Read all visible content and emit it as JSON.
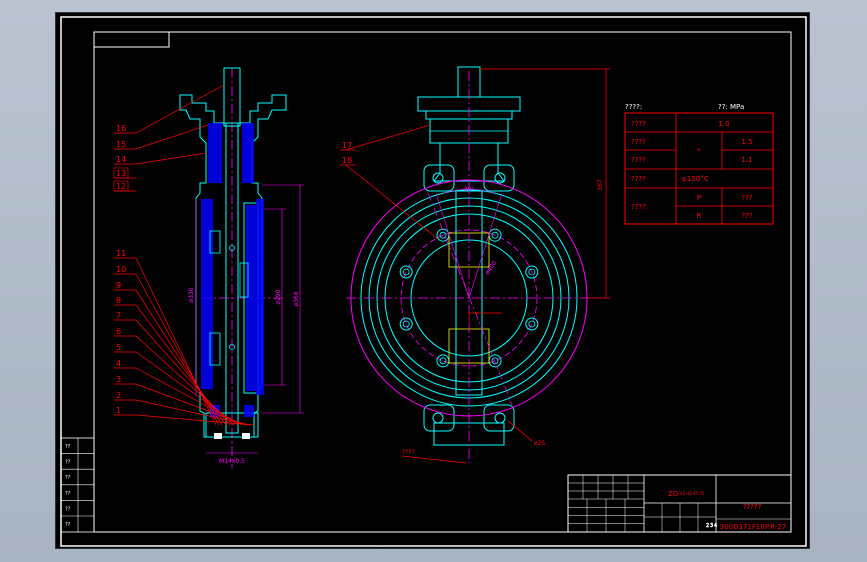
{
  "colors": {
    "background": "#000000",
    "frame": "#ffffff",
    "outline": "#00ffff",
    "leader": "#ff0000",
    "hatch": "#0000ff",
    "dimension": "#ff00ff",
    "centerline": "#ffff00",
    "text_white": "#ffffff"
  },
  "part_numbers_left": [
    "16",
    "15",
    "14",
    "13",
    "12",
    "11",
    "10",
    "9",
    "8",
    "7",
    "6",
    "5",
    "4",
    "3",
    "2",
    "1"
  ],
  "part_numbers_right": [
    "17",
    "18"
  ],
  "dimensions": {
    "flange_dia": "ø330",
    "seat_dia": "ø290",
    "outer_dia": "ø368",
    "height": "367",
    "bolt_circle": "ø25",
    "angle": "30°",
    "pcd": "ø400",
    "bottom_thread": "M14x0.5",
    "bottom_note": "????"
  },
  "spec_table": {
    "header_left": "????:",
    "header_right": "??: MPa",
    "rows": [
      {
        "label": "????",
        "mid": "",
        "value": "1.0"
      },
      {
        "label": "????",
        "mid": "*",
        "value": "1.5"
      },
      {
        "label": "????",
        "mid": "",
        "value": "1.1"
      },
      {
        "label": "????",
        "mid": "",
        "value": "≤150°C"
      },
      {
        "label": "????",
        "mid": "P",
        "value": "???"
      },
      {
        "label": "",
        "mid": "R",
        "value": "???"
      }
    ]
  },
  "title_block": {
    "material": "ZG",
    "material_note": "45-45-45.45",
    "name": "?????",
    "drawing_no": "300D371F10P.R-27",
    "scale_marks": [
      "2",
      "3",
      "4"
    ]
  },
  "side_block_rows": [
    "??",
    "??",
    "??",
    "??",
    "??",
    "??"
  ]
}
